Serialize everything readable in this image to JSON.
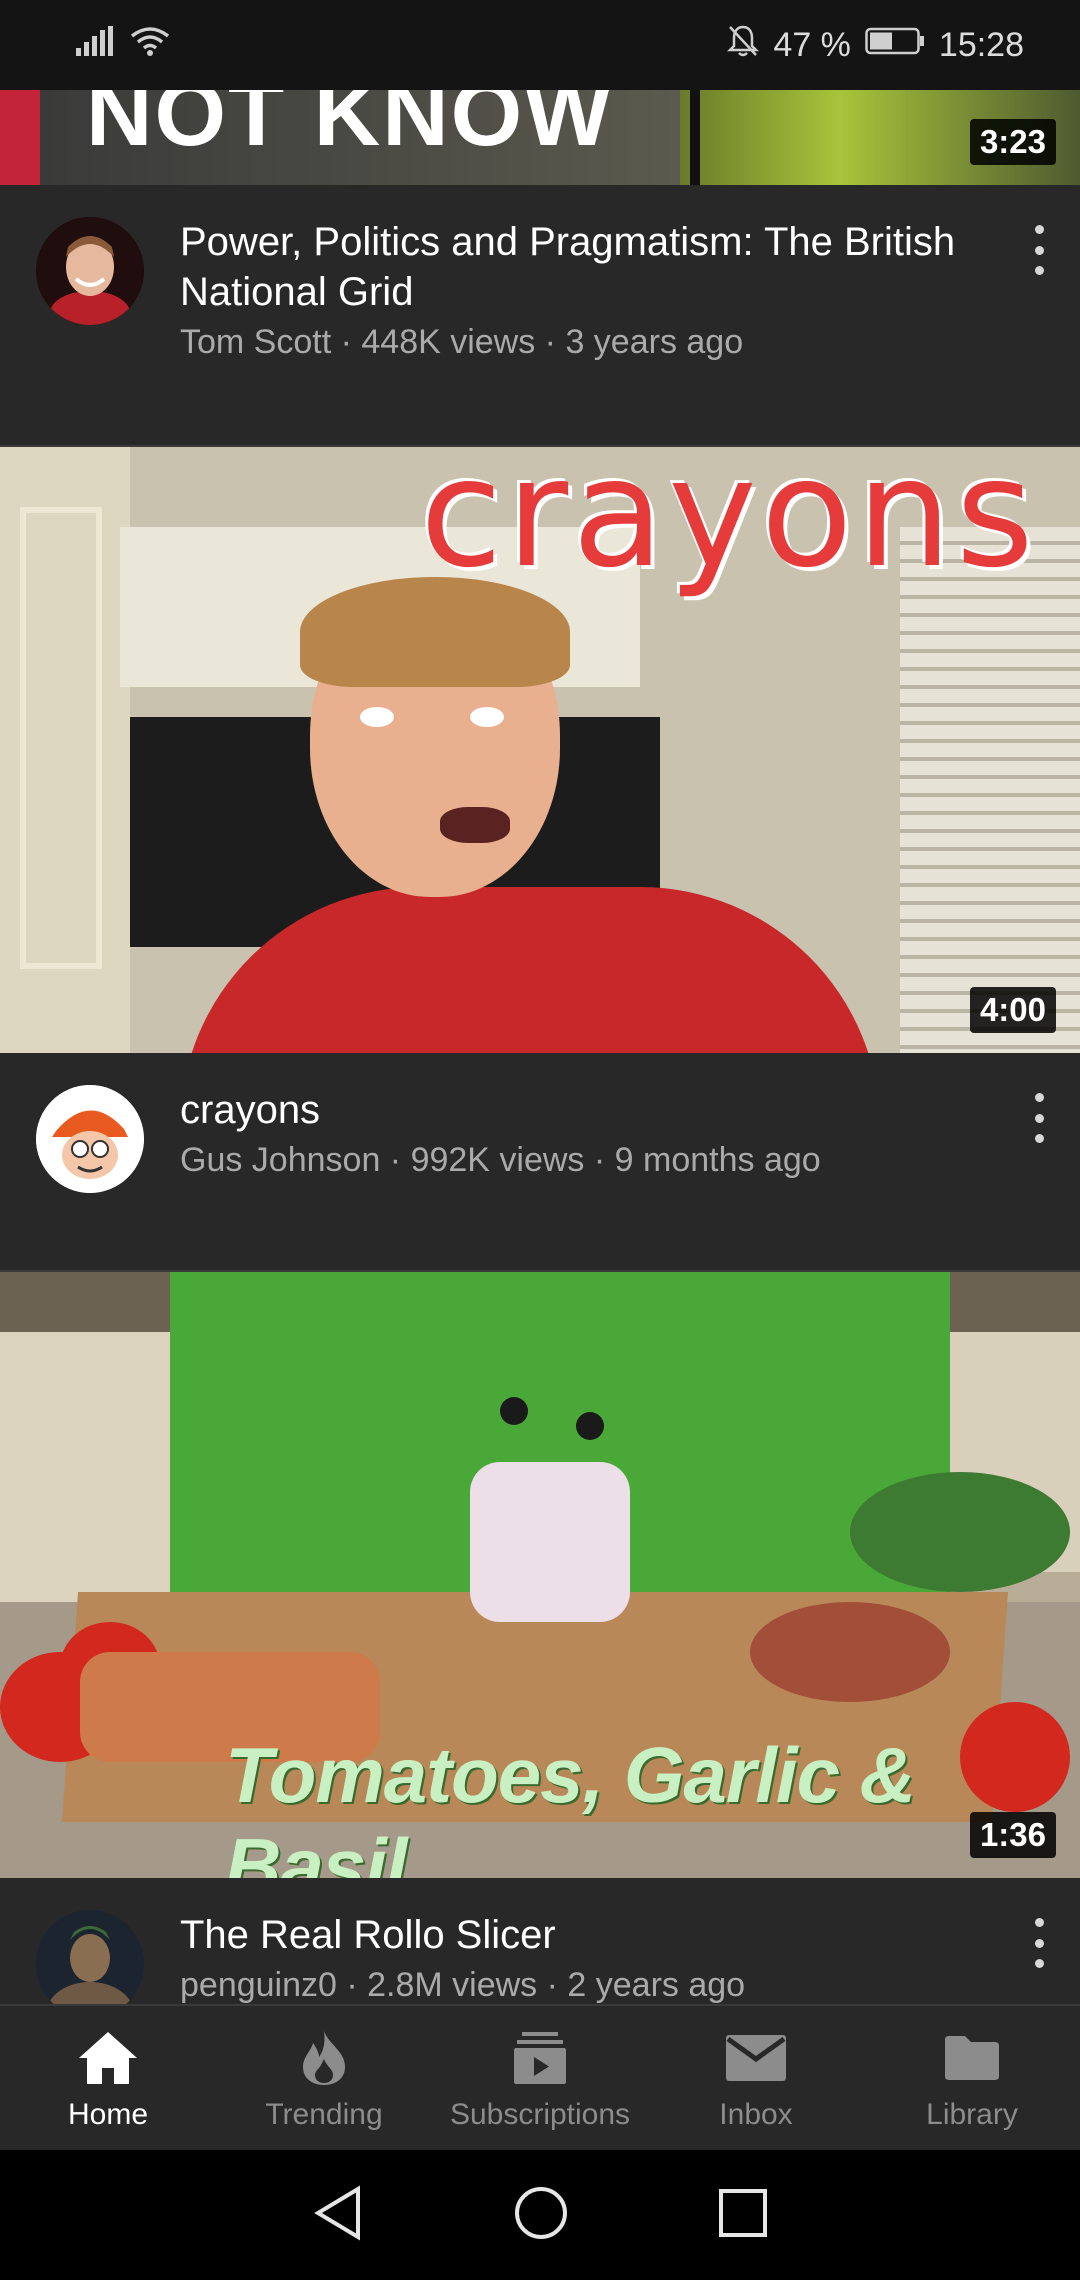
{
  "status_bar": {
    "battery_percent": "47 %",
    "time": "15:28"
  },
  "videos": [
    {
      "thumbnail_text": "NOT KNOW",
      "duration": "3:23",
      "title": "Power, Politics and Pragmatism: The British National Grid",
      "subtitle": "Tom Scott · 448K views · 3 years ago"
    },
    {
      "thumbnail_text": "crayons",
      "duration": "4:00",
      "title": "crayons",
      "subtitle": "Gus Johnson · 992K views · 9 months ago"
    },
    {
      "thumbnail_text": "Tomatoes, Garlic & Basil",
      "duration": "1:36",
      "title": "The Real Rollo Slicer",
      "subtitle": "penguinz0 · 2.8M views · 2 years ago"
    }
  ],
  "bottom_nav": {
    "home": "Home",
    "trending": "Trending",
    "subscriptions": "Subscriptions",
    "inbox": "Inbox",
    "library": "Library"
  },
  "colors": {
    "background": "#282828",
    "status_bar": "#141414",
    "secondary_text": "#aaaaaa",
    "inactive_nav": "#8c8c8c"
  }
}
